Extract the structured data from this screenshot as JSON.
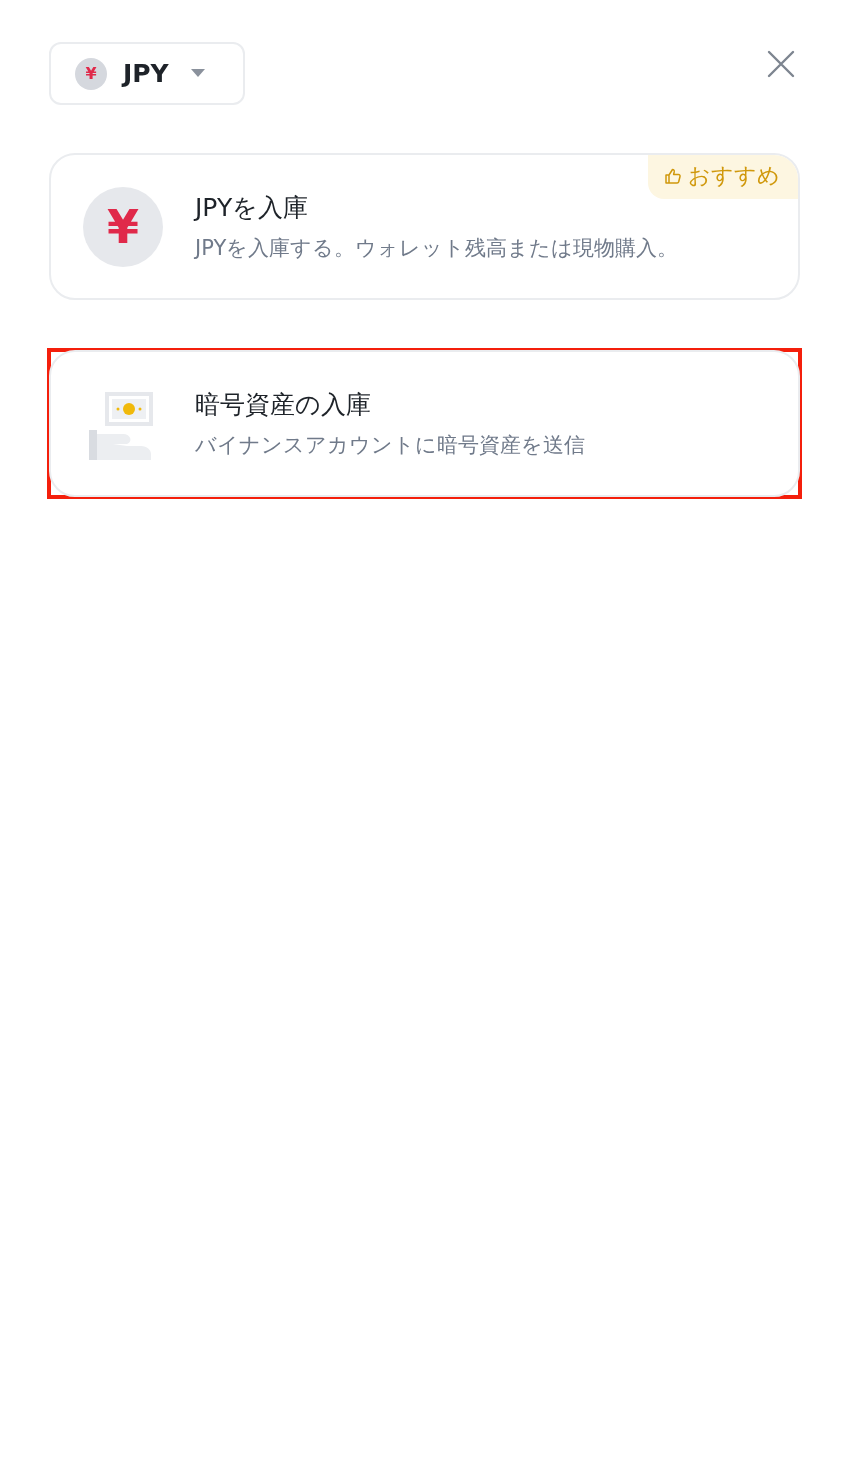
{
  "currency_selector": {
    "symbol": "¥",
    "code": "JPY"
  },
  "options": [
    {
      "kind": "fiat",
      "symbol": "¥",
      "title": "JPYを入庫",
      "description": "JPYを入庫する。ウォレット残高または現物購入。",
      "badge": "おすすめ",
      "highlighted": false
    },
    {
      "kind": "crypto",
      "title": "暗号資産の入庫",
      "description": "バイナンスアカウントに暗号資産を送信",
      "highlighted": true
    }
  ]
}
